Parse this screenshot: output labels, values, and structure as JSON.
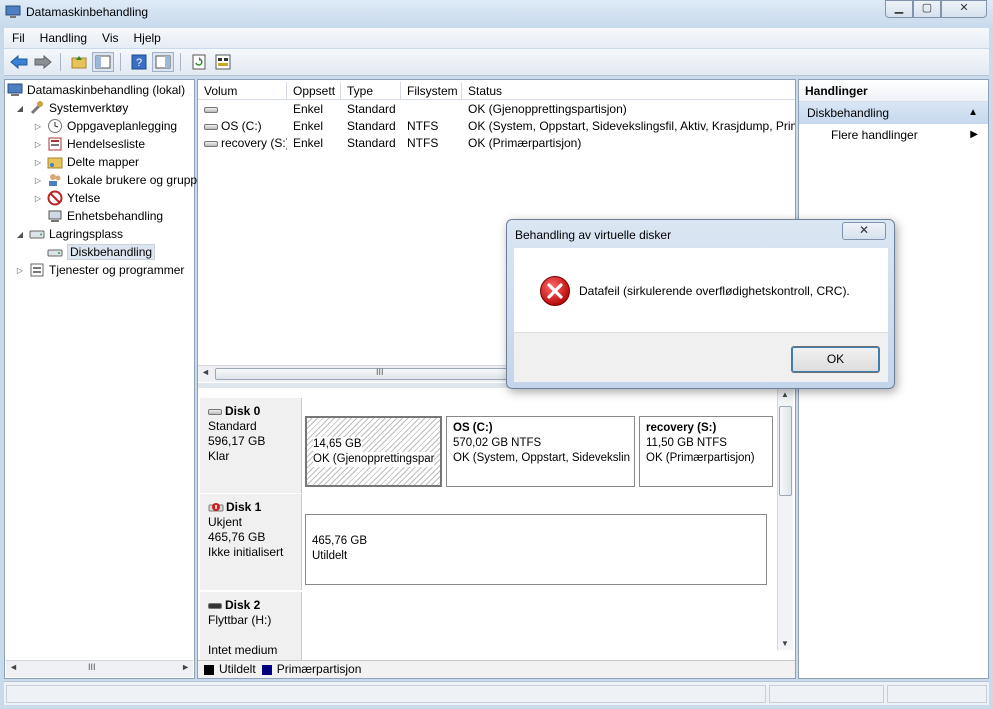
{
  "window": {
    "title": "Datamaskinbehandling",
    "min": "▁",
    "max": "▢",
    "close": "✕"
  },
  "menu": [
    "Fil",
    "Handling",
    "Vis",
    "Hjelp"
  ],
  "tree": {
    "root": "Datamaskinbehandling (lokal)",
    "systemtools": "Systemverktøy",
    "task": "Oppgaveplanlegging",
    "events": "Hendelsesliste",
    "shared": "Delte mapper",
    "users": "Lokale brukere og grupp",
    "perf": "Ytelse",
    "devices": "Enhetsbehandling",
    "storage": "Lagringsplass",
    "diskmgmt": "Diskbehandling",
    "services": "Tjenester og programmer"
  },
  "volumes": {
    "headers": [
      "Volum",
      "Oppsett",
      "Type",
      "Filsystem",
      "Status"
    ],
    "rows": [
      [
        "",
        "Enkel",
        "Standard",
        "",
        "OK (Gjenopprettingspartisjon)"
      ],
      [
        "OS (C:)",
        "Enkel",
        "Standard",
        "NTFS",
        "OK (System, Oppstart, Sidevekslingsfil, Aktiv, Krasjdump, Prim"
      ],
      [
        "recovery (S:)",
        "Enkel",
        "Standard",
        "NTFS",
        "OK (Primærpartisjon)"
      ]
    ]
  },
  "disks": {
    "disk0": {
      "name": "Disk 0",
      "type": "Standard",
      "size": "596,17 GB",
      "state": "Klar",
      "p1": {
        "size": "14,65 GB",
        "status": "OK (Gjenopprettingspar"
      },
      "p2": {
        "name": "OS  (C:)",
        "size": "570,02 GB NTFS",
        "status": "OK (System, Oppstart, Sidevekslin"
      },
      "p3": {
        "name": "recovery  (S:)",
        "size": "11,50 GB NTFS",
        "status": "OK (Primærpartisjon)"
      }
    },
    "disk1": {
      "name": "Disk 1",
      "type": "Ukjent",
      "size": "465,76 GB",
      "state": "Ikke initialisert",
      "p1": {
        "size": "465,76 GB",
        "status": "Utildelt"
      }
    },
    "disk2": {
      "name": "Disk 2",
      "type": "Flyttbar (H:)",
      "state": "Intet medium"
    }
  },
  "legend": {
    "unalloc": "Utildelt",
    "primary": "Primærpartisjon",
    "unalloc_color": "#000000",
    "primary_color": "#000080"
  },
  "actions": {
    "header": "Handlinger",
    "group": "Diskbehandling",
    "more": "Flere handlinger"
  },
  "dialog": {
    "title": "Behandling av virtuelle disker",
    "message": "Datafeil (sirkulerende overflødighetskontroll, CRC).",
    "ok": "OK",
    "close": "✕",
    "icon": "error-icon"
  },
  "scroll": {
    "grip": "III",
    "up": "▲",
    "down": "▼",
    "left": "◄",
    "right": "►"
  }
}
